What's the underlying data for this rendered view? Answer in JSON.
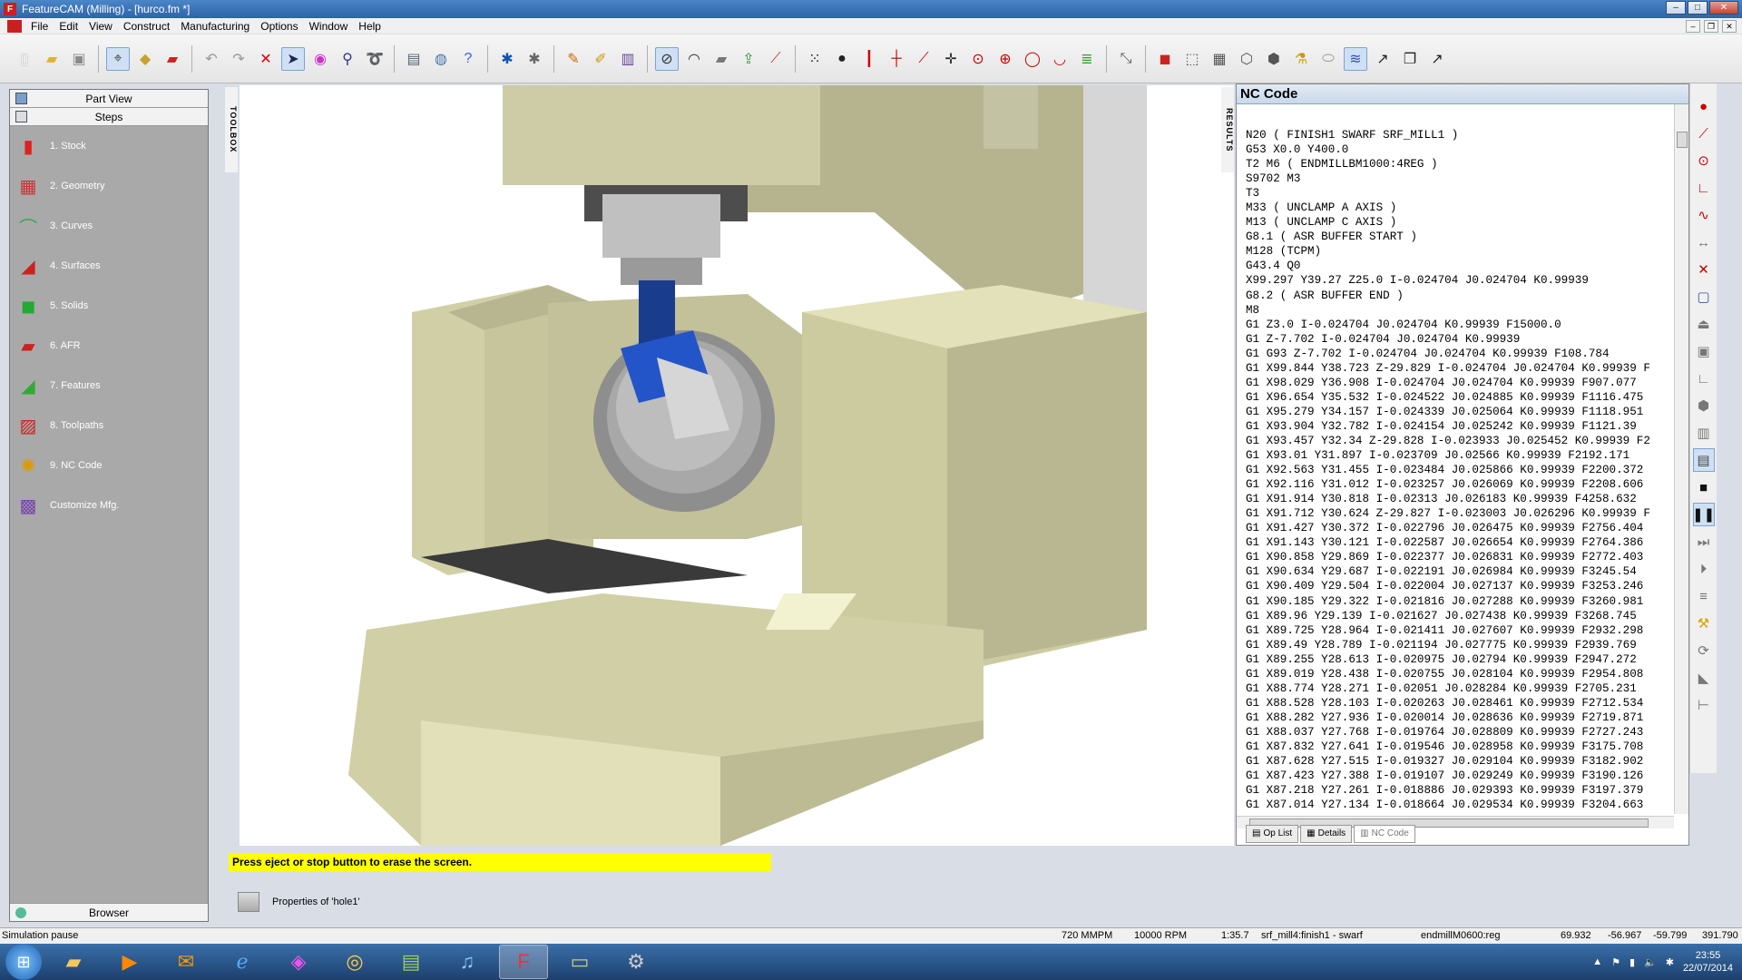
{
  "app": {
    "title": "FeatureCAM (Milling) - [hurco.fm *]"
  },
  "window_buttons": {
    "minimize": "–",
    "maximize": "□",
    "close": "✕"
  },
  "menu": [
    "File",
    "Edit",
    "View",
    "Construct",
    "Manufacturing",
    "Options",
    "Window",
    "Help"
  ],
  "left_panel": {
    "part_view": "Part View",
    "steps": "Steps",
    "items": [
      {
        "label": "1. Stock",
        "icon": "stock-icon"
      },
      {
        "label": "2. Geometry",
        "icon": "geometry-icon"
      },
      {
        "label": "3. Curves",
        "icon": "curves-icon"
      },
      {
        "label": "4. Surfaces",
        "icon": "surfaces-icon"
      },
      {
        "label": "5. Solids",
        "icon": "solids-icon"
      },
      {
        "label": "6. AFR",
        "icon": "afr-icon"
      },
      {
        "label": "7. Features",
        "icon": "features-icon"
      },
      {
        "label": "8. Toolpaths",
        "icon": "toolpaths-icon"
      },
      {
        "label": "9. NC Code",
        "icon": "nc-code-icon"
      },
      {
        "label": "Customize Mfg.",
        "icon": "customize-mfg-icon"
      }
    ],
    "browser": "Browser"
  },
  "side_tabs": {
    "toolbox": "TOOLBOX",
    "results": "RESULTS"
  },
  "nc_panel": {
    "title": "NC Code",
    "lines": [
      "N20 ( FINISH1 SWARF SRF_MILL1 )",
      "G53 X0.0 Y400.0",
      "T2 M6 ( ENDMILLBM1000:4REG )",
      "S9702 M3",
      "T3",
      "M33 ( UNCLAMP A AXIS )",
      "M13 ( UNCLAMP C AXIS )",
      "G8.1 ( ASR BUFFER START )",
      "M128 (TCPM)",
      "G43.4 Q0",
      "X99.297 Y39.27 Z25.0 I-0.024704 J0.024704 K0.99939",
      "G8.2 ( ASR BUFFER END )",
      "M8",
      "G1 Z3.0 I-0.024704 J0.024704 K0.99939 F15000.0",
      "G1 Z-7.702 I-0.024704 J0.024704 K0.99939",
      "G1 G93 Z-7.702 I-0.024704 J0.024704 K0.99939 F108.784",
      "G1 X99.844 Y38.723 Z-29.829 I-0.024704 J0.024704 K0.99939 F",
      "G1 X98.029 Y36.908 I-0.024704 J0.024704 K0.99939 F907.077",
      "G1 X96.654 Y35.532 I-0.024522 J0.024885 K0.99939 F1116.475",
      "G1 X95.279 Y34.157 I-0.024339 J0.025064 K0.99939 F1118.951",
      "G1 X93.904 Y32.782 I-0.024154 J0.025242 K0.99939 F1121.39",
      "G1 X93.457 Y32.34 Z-29.828 I-0.023933 J0.025452 K0.99939 F2",
      "G1 X93.01 Y31.897 I-0.023709 J0.02566 K0.99939 F2192.171",
      "G1 X92.563 Y31.455 I-0.023484 J0.025866 K0.99939 F2200.372",
      "G1 X92.116 Y31.012 I-0.023257 J0.026069 K0.99939 F2208.606",
      "G1 X91.914 Y30.818 I-0.02313 J0.026183 K0.99939 F4258.632",
      "G1 X91.712 Y30.624 Z-29.827 I-0.023003 J0.026296 K0.99939 F",
      "G1 X91.427 Y30.372 I-0.022796 J0.026475 K0.99939 F2756.404",
      "G1 X91.143 Y30.121 I-0.022587 J0.026654 K0.99939 F2764.386",
      "G1 X90.858 Y29.869 I-0.022377 J0.026831 K0.99939 F2772.403",
      "G1 X90.634 Y29.687 I-0.022191 J0.026984 K0.99939 F3245.54",
      "G1 X90.409 Y29.504 I-0.022004 J0.027137 K0.99939 F3253.246",
      "G1 X90.185 Y29.322 I-0.021816 J0.027288 K0.99939 F3260.981",
      "G1 X89.96 Y29.139 I-0.021627 J0.027438 K0.99939 F3268.745",
      "G1 X89.725 Y28.964 I-0.021411 J0.027607 K0.99939 F2932.298",
      "G1 X89.49 Y28.789 I-0.021194 J0.027775 K0.99939 F2939.769",
      "G1 X89.255 Y28.613 I-0.020975 J0.02794 K0.99939 F2947.272",
      "G1 X89.019 Y28.438 I-0.020755 J0.028104 K0.99939 F2954.808",
      "G1 X88.774 Y28.271 I-0.02051 J0.028284 K0.99939 F2705.231",
      "G1 X88.528 Y28.103 I-0.020263 J0.028461 K0.99939 F2712.534",
      "G1 X88.282 Y27.936 I-0.020014 J0.028636 K0.99939 F2719.871",
      "G1 X88.037 Y27.768 I-0.019764 J0.028809 K0.99939 F2727.243",
      "G1 X87.832 Y27.641 I-0.019546 J0.028958 K0.99939 F3175.708",
      "G1 X87.628 Y27.515 I-0.019327 J0.029104 K0.99939 F3182.902",
      "G1 X87.423 Y27.388 I-0.019107 J0.029249 K0.99939 F3190.126",
      "G1 X87.218 Y27.261 I-0.018886 J0.029393 K0.99939 F3197.379",
      "G1 X87.014 Y27.134 I-0.018664 J0.029534 K0.99939 F3204.663"
    ],
    "tabs": [
      "Op List",
      "Details",
      "NC Code"
    ]
  },
  "message": "Press eject or stop button to erase the screen.",
  "properties_label": "Properties of 'hole1'",
  "status": {
    "left": "Simulation pause",
    "feed": "720 MMPM",
    "speed": "10000 RPM",
    "time": "1:35.7",
    "operation": "srf_mill4:finish1 - swarf",
    "tool": "endmillM0600:reg",
    "x": "69.932",
    "y": "-56.967",
    "z": "-59.799",
    "w": "391.790"
  },
  "clock": {
    "time": "23:55",
    "date": "22/07/2014"
  }
}
